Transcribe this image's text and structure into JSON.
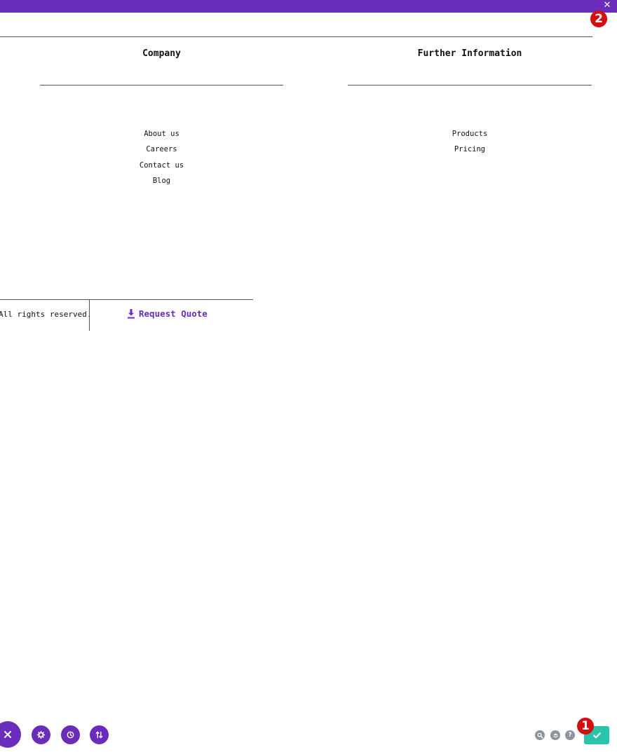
{
  "topbar": {
    "color": "#6a2cba",
    "close_icon": "close-icon"
  },
  "annotations": {
    "badge_1": "1",
    "badge_2": "2"
  },
  "footer_columns": {
    "company": {
      "title": "Company",
      "links": [
        "About us",
        "Careers",
        "Contact us",
        "Blog"
      ]
    },
    "further": {
      "title": "Further Information",
      "links": [
        "Products",
        "Pricing"
      ]
    }
  },
  "bottom_bar": {
    "copyright": "All rights reserved.",
    "quote_label": "Request Quote",
    "quote_icon": "download-icon",
    "accent": "#6a2cba"
  },
  "builder_toolbar": {
    "left": [
      "close-icon",
      "gear-icon",
      "history-icon",
      "sort-icon"
    ],
    "right": [
      "zoom-icon",
      "layers-icon",
      "help-icon",
      "check-icon"
    ],
    "help_glyph": "?",
    "save_color": "#29c4a9"
  }
}
